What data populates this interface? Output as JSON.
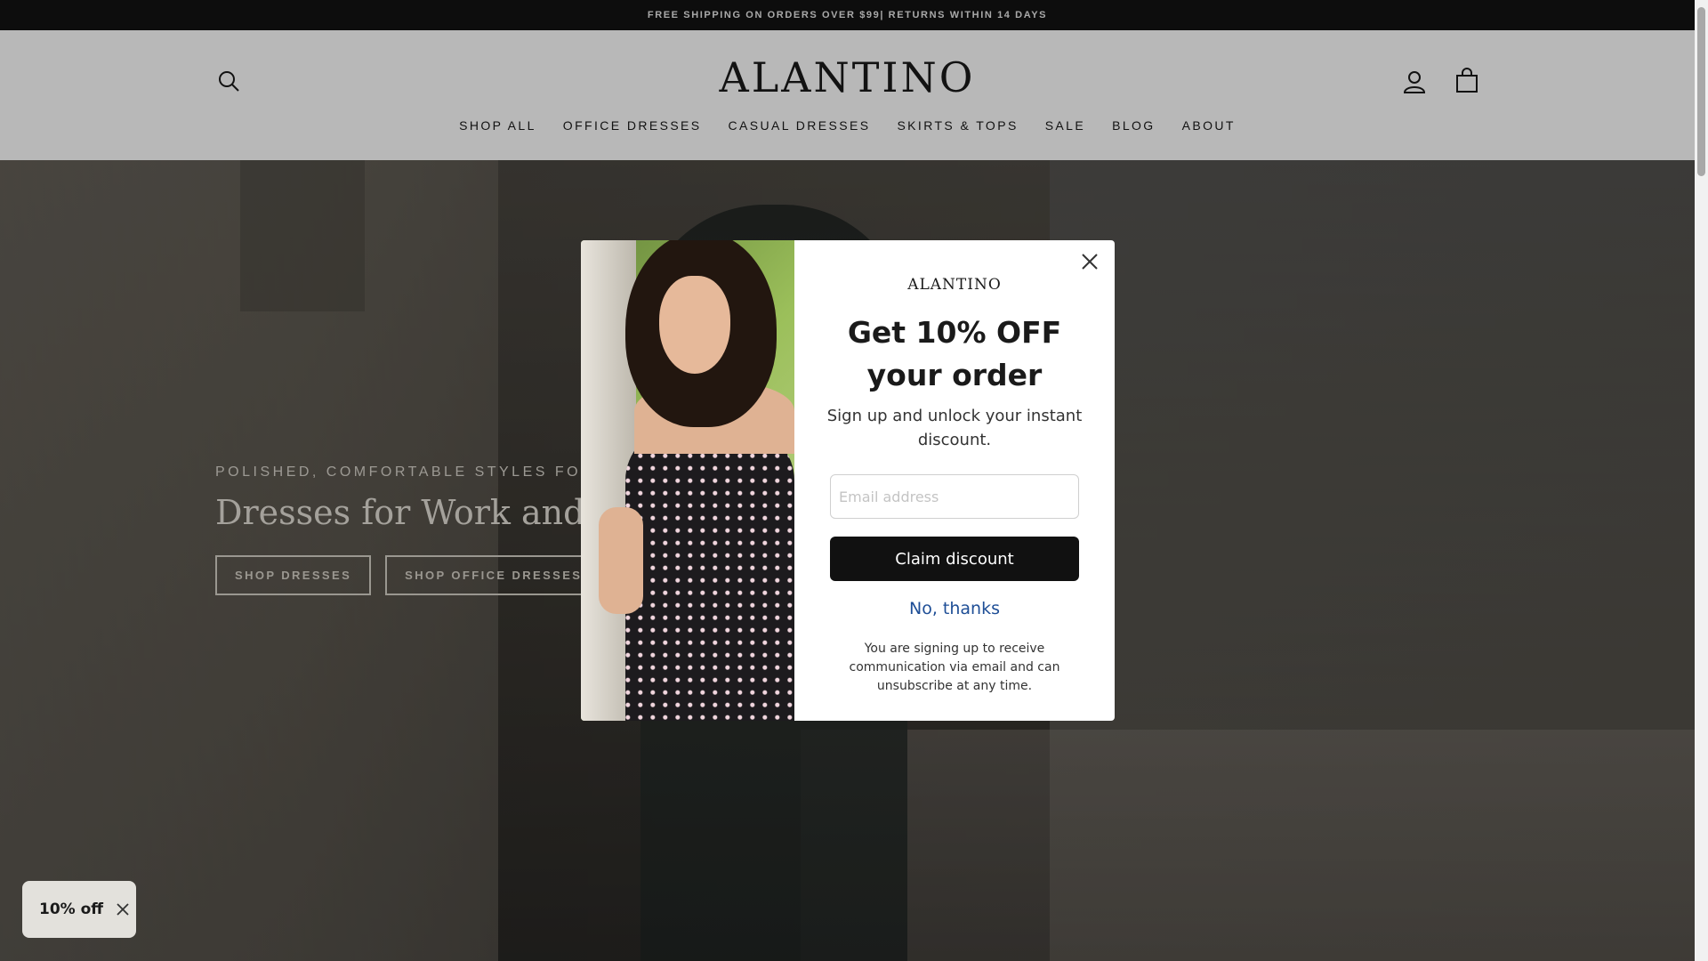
{
  "announcement": {
    "text": "FREE SHIPPING ON ORDERS OVER $99| RETURNS WITHIN 14 DAYS"
  },
  "header": {
    "logo": "ALANTINO",
    "search_icon": "search-icon",
    "account_icon": "user-icon",
    "cart_icon": "shopping-bag-icon"
  },
  "nav": {
    "items": [
      {
        "label": "SHOP ALL"
      },
      {
        "label": "OFFICE DRESSES"
      },
      {
        "label": "CASUAL DRESSES"
      },
      {
        "label": "SKIRTS & TOPS"
      },
      {
        "label": "SALE"
      },
      {
        "label": "BLOG"
      },
      {
        "label": "ABOUT"
      }
    ]
  },
  "hero": {
    "kicker": "POLISHED, COMFORTABLE STYLES FOR THE",
    "title": "Dresses for Work and Eve",
    "buttons": [
      {
        "label": "SHOP DRESSES"
      },
      {
        "label": "SHOP OFFICE DRESSES"
      }
    ]
  },
  "popup": {
    "brand": "ALANTINO",
    "headline": "Get 10% OFF your order",
    "subtext": "Sign up and unlock your instant discount.",
    "email_placeholder": "Email address",
    "claim_label": "Claim discount",
    "decline_label": "No, thanks",
    "disclaimer": "You are signing up to receive communication via email and can unsubscribe at any time.",
    "close_icon": "close-icon"
  },
  "discount_tab": {
    "label": "10% off",
    "close_icon": "close-icon"
  },
  "colors": {
    "popup_button": "#111111",
    "decline_link": "#1e4e96",
    "announcement_bg": "#121212"
  }
}
